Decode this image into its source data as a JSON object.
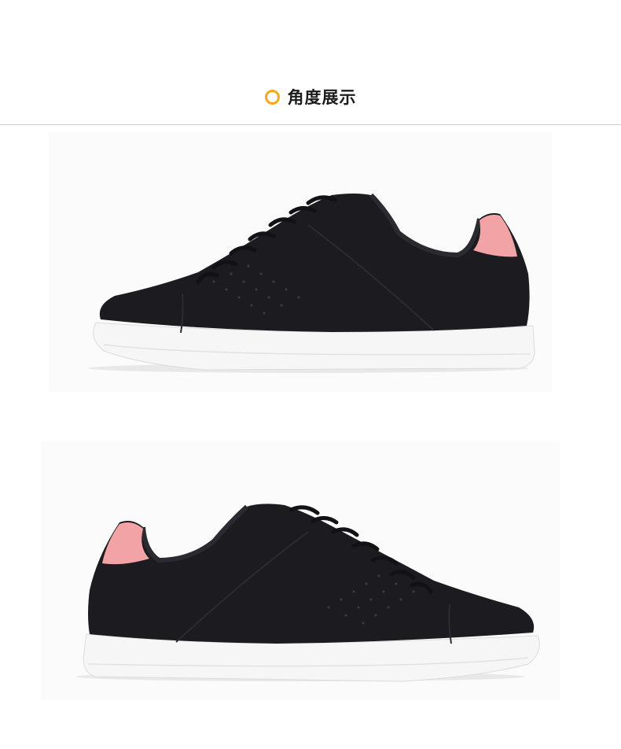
{
  "section": {
    "title": "角度展示",
    "bullet_icon": "circle-outline-icon",
    "accent_color": "#f4a81c"
  },
  "images": [
    {
      "subject": "sneaker-side-view",
      "colors": {
        "upper": "#1c1b20",
        "heel_tab": "#f2a3a6",
        "sole": "#f6f6f6"
      }
    },
    {
      "subject": "sneaker-mirrored-side-view",
      "colors": {
        "upper": "#1c1b20",
        "heel_tab": "#f2a3a6",
        "sole": "#f6f6f6"
      }
    }
  ]
}
